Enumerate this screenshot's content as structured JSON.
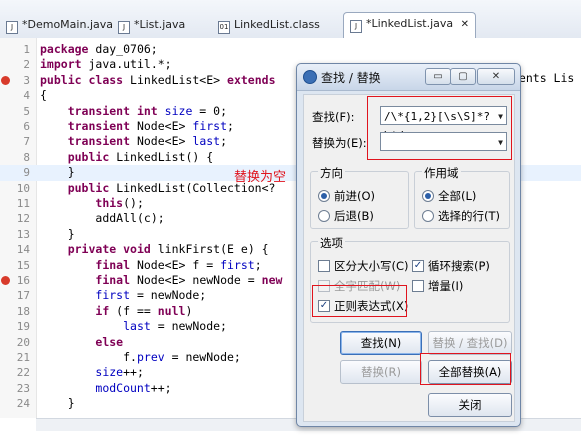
{
  "tabs": [
    {
      "label": "*DemoMain.java",
      "icon": "java-file-icon"
    },
    {
      "label": "*List.java",
      "icon": "java-file-icon"
    },
    {
      "label": "LinkedList.class",
      "icon": "class-file-icon"
    },
    {
      "label": "*LinkedList.java",
      "icon": "java-file-icon",
      "close": "✕"
    }
  ],
  "code_lines": [
    {
      "n": "1",
      "text": "package day_0706;"
    },
    {
      "n": "2",
      "text": "import java.util.*;"
    },
    {
      "n": "3",
      "text": "public class LinkedList<E> extends"
    },
    {
      "n": "4",
      "text": "{"
    },
    {
      "n": "5",
      "text": "    transient int size = 0;"
    },
    {
      "n": "6",
      "text": "    transient Node<E> first;"
    },
    {
      "n": "7",
      "text": "    transient Node<E> last;"
    },
    {
      "n": "8",
      "text": "    public LinkedList() {"
    },
    {
      "n": "9",
      "text": "    }"
    },
    {
      "n": "10",
      "text": "    public LinkedList(Collection<?"
    },
    {
      "n": "11",
      "text": "        this();"
    },
    {
      "n": "12",
      "text": "        addAll(c);"
    },
    {
      "n": "13",
      "text": "    }"
    },
    {
      "n": "14",
      "text": "    private void linkFirst(E e) {"
    },
    {
      "n": "15",
      "text": "        final Node<E> f = first;"
    },
    {
      "n": "16",
      "text": "        final Node<E> newNode = new"
    },
    {
      "n": "17",
      "text": "        first = newNode;"
    },
    {
      "n": "18",
      "text": "        if (f == null)"
    },
    {
      "n": "19",
      "text": "            last = newNode;"
    },
    {
      "n": "20",
      "text": "        else"
    },
    {
      "n": "21",
      "text": "            f.prev = newNode;"
    },
    {
      "n": "22",
      "text": "        size++;"
    },
    {
      "n": "23",
      "text": "        modCount++;"
    },
    {
      "n": "24",
      "text": "    }"
    }
  ],
  "code_right_fragment": "ments Lis",
  "annotation": "替换为空",
  "dialog": {
    "title": "查找 / 替换",
    "find_label": "查找(F):",
    "find_value": "/\\*{1,2}[\\s\\S]*?\\*/",
    "replace_label": "替换为(E):",
    "replace_value": "",
    "direction_title": "方向",
    "dir_forward": "前进(O)",
    "dir_backward": "后退(B)",
    "scope_title": "作用域",
    "scope_all": "全部(L)",
    "scope_selected": "选择的行(T)",
    "options_title": "选项",
    "opt_case": "区分大小写(C)",
    "opt_wrap": "循环搜索(P)",
    "opt_whole": "全字匹配(W)",
    "opt_incremental": "增量(I)",
    "opt_regex": "正则表达式(X)",
    "btn_find": "查找(N)",
    "btn_replace_find": "替换 / 查找(D)",
    "btn_replace": "替换(R)",
    "btn_replace_all": "全部替换(A)",
    "btn_close": "关闭",
    "win_min": "▭",
    "win_max": "▢",
    "win_close": "✕"
  }
}
